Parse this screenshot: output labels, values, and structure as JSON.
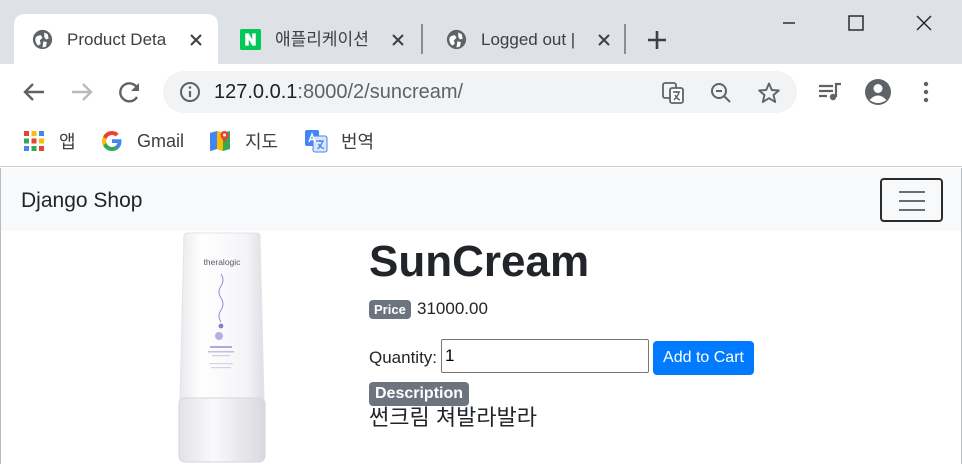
{
  "browser": {
    "tabs": [
      {
        "title": "Product Deta",
        "favicon": "globe-icon",
        "active": true
      },
      {
        "title": "애플리케이션",
        "favicon": "naver-n-icon",
        "active": false
      },
      {
        "title": "Logged out |",
        "favicon": "globe-icon",
        "active": false
      }
    ],
    "omnibox": {
      "host": "127.0.0.1",
      "path": ":8000/2/suncream/"
    },
    "bookmarks": [
      {
        "label": "앱",
        "icon": "apps-grid-icon"
      },
      {
        "label": "Gmail",
        "icon": "google-g-icon"
      },
      {
        "label": "지도",
        "icon": "maps-pin-icon"
      },
      {
        "label": "번역",
        "icon": "translate-icon"
      }
    ]
  },
  "site": {
    "brand": "Django Shop"
  },
  "product": {
    "name": "SunCream",
    "price_label": "Price",
    "price": "31000.00",
    "quantity_label": "Quantity:",
    "quantity_value": "1",
    "add_to_cart_label": "Add to Cart",
    "description_label": "Description",
    "description": "썬크림 쳐발라발라",
    "image": {
      "brand_text": "theralogic"
    }
  },
  "colors": {
    "primary": "#007bff",
    "badge": "#6c757d",
    "navbar_bg": "#f8f9fa",
    "tabstrip_bg": "#dee1e6",
    "omnibox_bg": "#f1f3f4"
  }
}
